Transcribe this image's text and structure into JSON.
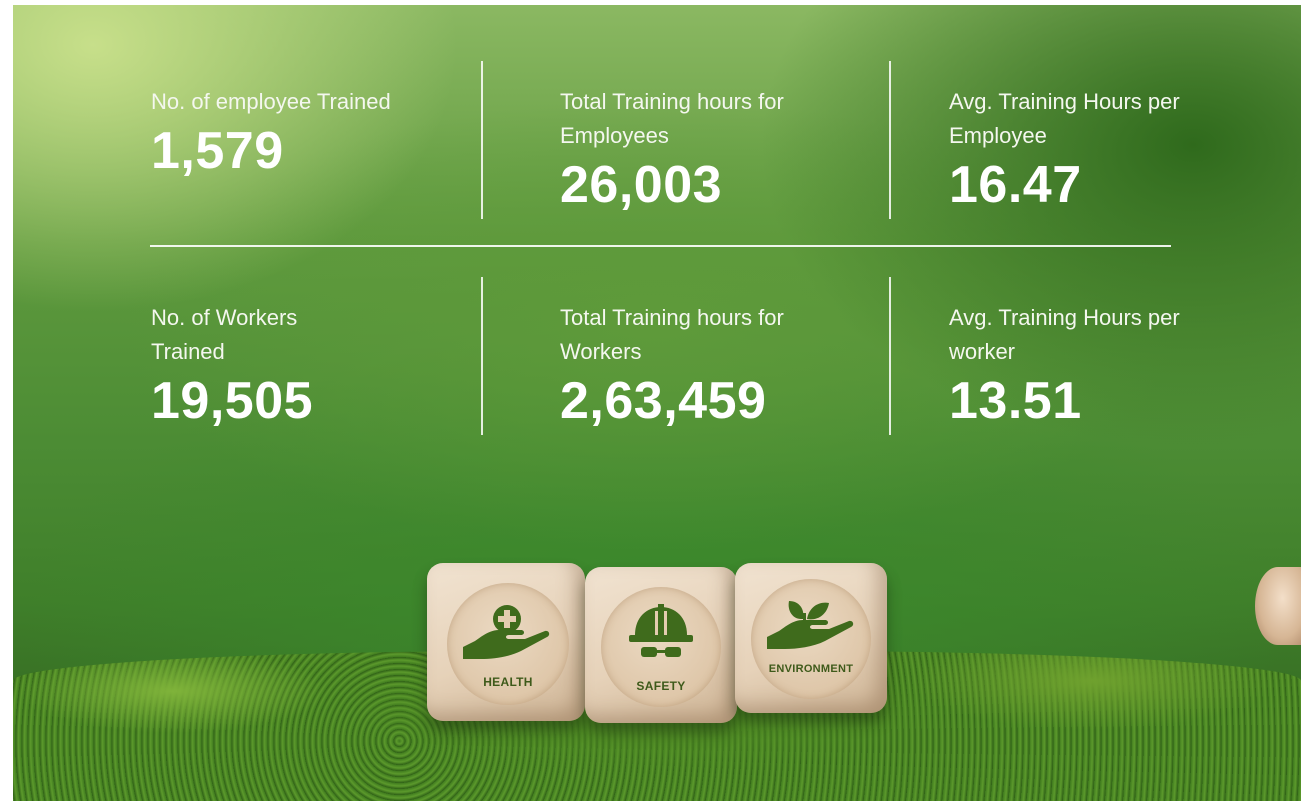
{
  "stats": [
    {
      "label": "No. of employee Trained",
      "value": "1,579"
    },
    {
      "label": "Total Training hours for Employees",
      "value": "26,003"
    },
    {
      "label": "Avg. Training Hours per Employee",
      "value": "16.47"
    },
    {
      "label": "No. of Workers Trained",
      "value": "19,505"
    },
    {
      "label": "Total Training hours for Workers",
      "value": "2,63,459"
    },
    {
      "label": "Avg. Training Hours per worker",
      "value": "13.51"
    }
  ],
  "cubes": [
    {
      "label": "HEALTH",
      "icon": "hand-plus-icon"
    },
    {
      "label": "SAFETY",
      "icon": "hard-hat-icon"
    },
    {
      "label": "ENVIRONMENT",
      "icon": "hand-leaf-icon"
    }
  ],
  "colors": {
    "text": "#ffffff",
    "icon_green": "#3f6b1c"
  }
}
